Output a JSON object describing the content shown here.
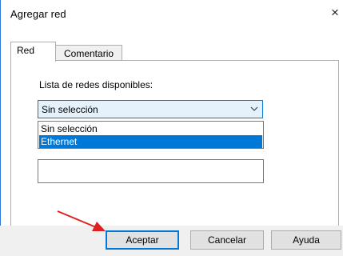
{
  "dialog": {
    "title": "Agregar red",
    "close_glyph": "×"
  },
  "tabs": [
    {
      "label": "Red",
      "active": true
    },
    {
      "label": "Comentario",
      "active": false
    }
  ],
  "network_list": {
    "label": "Lista de redes disponibles:",
    "selected_value": "Sin selección",
    "options": [
      "Sin selección",
      "Ethernet"
    ],
    "highlighted_option": "Ethernet"
  },
  "buttons": {
    "ok": "Aceptar",
    "cancel": "Cancelar",
    "help": "Ayuda"
  },
  "colors": {
    "accent": "#0078d7",
    "annotation_arrow": "#e02020"
  },
  "icons": {
    "close": "close-icon",
    "combo_arrow": "chevron-down-icon",
    "annotation": "red-arrow-icon"
  }
}
